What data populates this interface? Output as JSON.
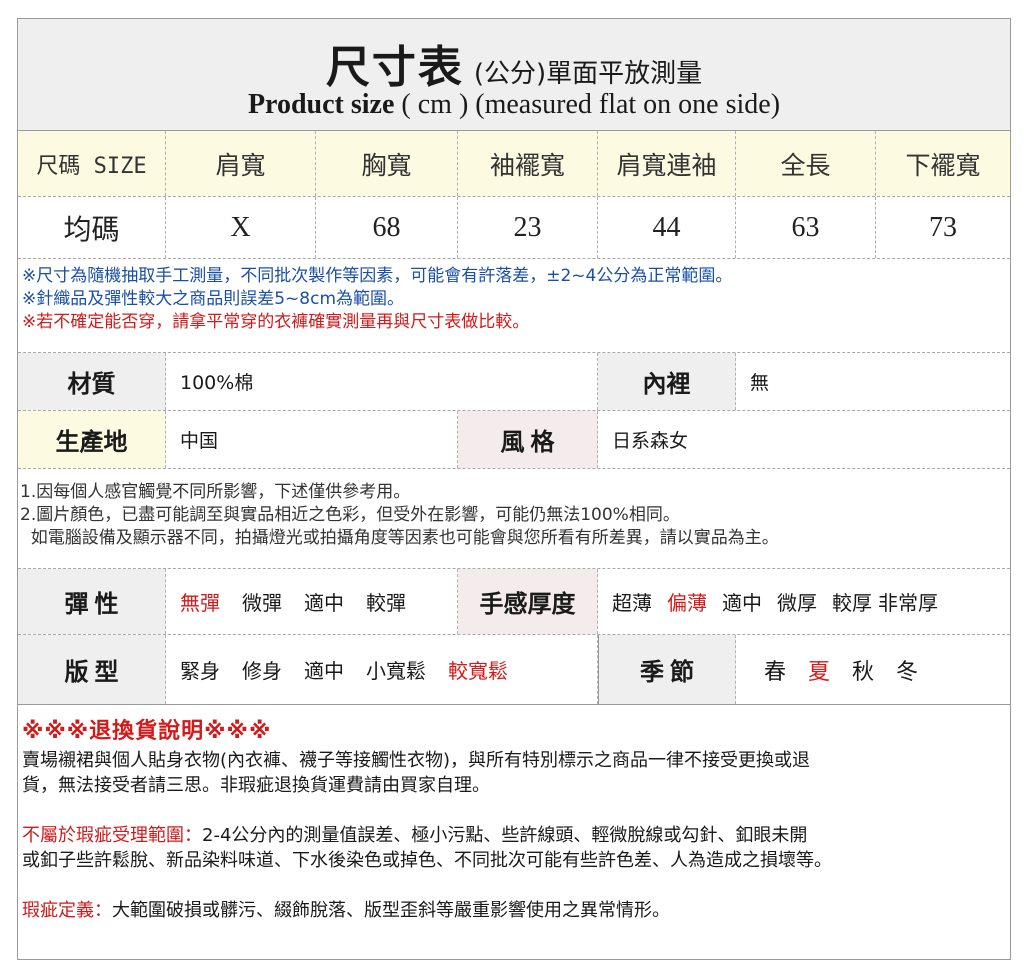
{
  "header": {
    "title_big": "尺寸表",
    "title_small": "(公分)單面平放測量",
    "sub_bold": "Product size",
    "sub_rest": " ( cm ) (measured flat on one side)"
  },
  "size_table": {
    "headers": [
      "尺碼 SIZE",
      "肩寬",
      "胸寬",
      "袖襬寬",
      "肩寬連袖",
      "全長",
      "下襬寬"
    ],
    "row": [
      "均碼",
      "X",
      "68",
      "23",
      "44",
      "63",
      "73"
    ]
  },
  "notes": {
    "line1": "※尺寸為隨機抽取手工測量，不同批次製作等因素，可能會有許落差，±2~4公分為正常範圍。",
    "line2": "※針織品及彈性較大之商品則誤差5~8cm為範圍。",
    "line3": "※若不確定能否穿，請拿平常穿的衣褲確實測量再與尺寸表做比較。"
  },
  "material": {
    "material_label": "材質",
    "material_value": "100%棉",
    "lining_label": "內裡",
    "lining_value": "無",
    "origin_label": "生產地",
    "origin_value": "中国",
    "style_label": "風 格",
    "style_value": "日系森女"
  },
  "remarks": {
    "line1": "1.因每個人感官觸覺不同所影響，下述僅供參考用。",
    "line2": "2.圖片顏色，已盡可能調至與實品相近之色彩，但受外在影響，可能仍無法100%相同。",
    "line3": "  如電腦設備及顯示器不同，拍攝燈光或拍攝角度等因素也可能會與您所看有所差異，請以實品為主。"
  },
  "attributes": {
    "elasticity_label": "彈 性",
    "elasticity_options": [
      "無彈",
      "微彈",
      "適中",
      "較彈"
    ],
    "elasticity_selected": "無彈",
    "thickness_label": "手感厚度",
    "thickness_options": [
      "超薄",
      "偏薄",
      "適中",
      "微厚",
      "較厚",
      "非常厚"
    ],
    "thickness_selected": "偏薄",
    "fit_label": "版 型",
    "fit_options": [
      "緊身",
      "修身",
      "適中",
      "小寬鬆",
      "較寬鬆"
    ],
    "fit_selected": "較寬鬆",
    "season_label": "季 節",
    "season_options": [
      "春",
      "夏",
      "秋",
      "冬"
    ],
    "season_selected": "夏"
  },
  "returns": {
    "title": "※※※退換貨說明※※※",
    "para1_line1": "賣場襯裙與個人貼身衣物(內衣褲、襪子等接觸性衣物)，與所有特別標示之商品一律不接受更換或退",
    "para1_line2": "貨，無法接受者請三思。非瑕疵退換貨運費請由買家自理。",
    "para2_label": "不屬於瑕疵受理範圍：",
    "para2_line1": "2-4公分內的測量值誤差、極小污點、些許線頭、輕微脫線或勾針、釦眼未開",
    "para2_line2": "或釦子些許鬆脫、新品染料味道、下水後染色或掉色、不同批次可能有些許色差、人為造成之損壞等。",
    "para3_label": "瑕疵定義：",
    "para3_text": "大範圍破損或髒污、綴飾脫落、版型歪斜等嚴重影響使用之異常情形。"
  },
  "colors": {
    "accent_red": "#d21a1a",
    "note_blue": "#1a4fa8",
    "header_gray": "#efefef",
    "cream": "#fdfae2"
  }
}
